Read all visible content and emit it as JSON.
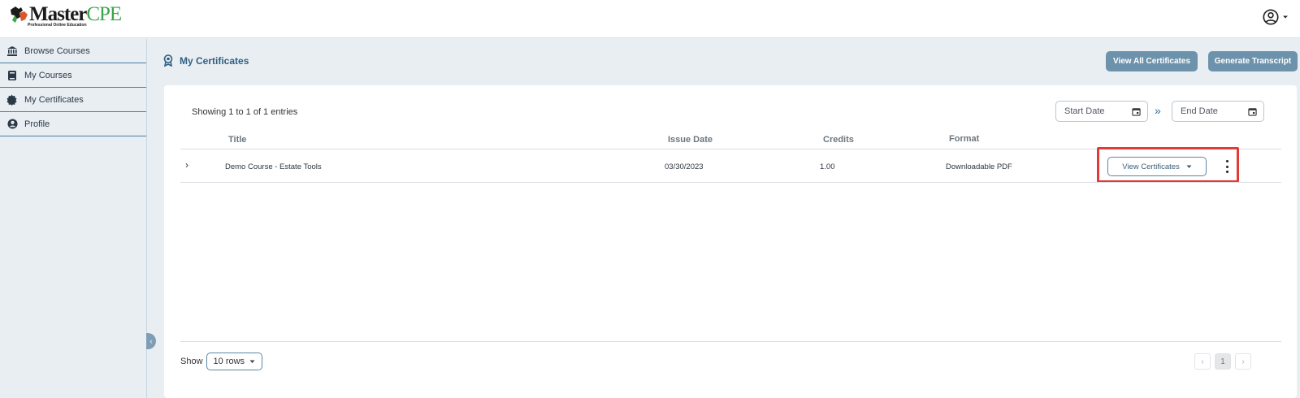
{
  "header": {
    "logo_master": "Master",
    "logo_cpe": "CPE",
    "logo_tagline": "Professional Online Education"
  },
  "sidebar": {
    "items": [
      {
        "label": "Browse Courses",
        "icon": "bank-icon"
      },
      {
        "label": "My Courses",
        "icon": "book-icon"
      },
      {
        "label": "My Certificates",
        "icon": "badge-icon"
      },
      {
        "label": "Profile",
        "icon": "user-circle-icon"
      }
    ]
  },
  "page": {
    "title": "My Certificates",
    "view_all_label": "View All Certificates",
    "generate_label": "Generate Transcript"
  },
  "table": {
    "showing_text": "Showing 1 to 1 of 1 entries",
    "start_date_placeholder": "Start Date",
    "end_date_placeholder": "End Date",
    "range_separator": "»",
    "columns": [
      "Title",
      "Issue Date",
      "Credits",
      "Format"
    ],
    "rows": [
      {
        "title": "Demo Course - Estate Tools",
        "issue_date": "03/30/2023",
        "credits": "1.00",
        "format": "Downloadable PDF",
        "action_label": "View Certificates"
      }
    ]
  },
  "footer": {
    "show_label": "Show",
    "rows_value": "10 rows",
    "current_page": "1",
    "prev_symbol": "‹",
    "next_symbol": "›"
  },
  "colors": {
    "accent": "#6d93ac",
    "title_blue": "#2f5f82",
    "highlight": "#e53935",
    "logo_green": "#3ba54a"
  }
}
